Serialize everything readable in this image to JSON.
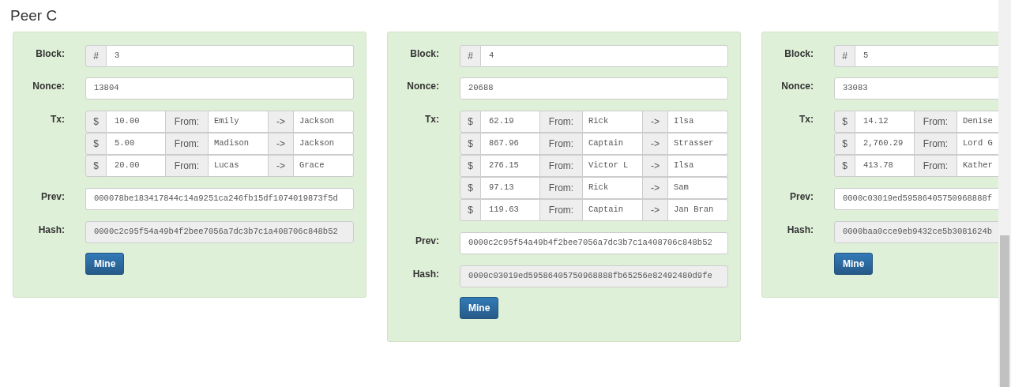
{
  "title": "Peer C",
  "blocks": [
    {
      "block_label": "Block:",
      "hash_symbol": "#",
      "block": "3",
      "nonce_label": "Nonce:",
      "nonce": "13804",
      "tx_label": "Tx:",
      "txs": [
        {
          "currency": "$",
          "amount": "10.00",
          "from_label": "From:",
          "from": "Emily",
          "arrow": "->",
          "to": "Jackson"
        },
        {
          "currency": "$",
          "amount": "5.00",
          "from_label": "From:",
          "from": "Madison",
          "arrow": "->",
          "to": "Jackson"
        },
        {
          "currency": "$",
          "amount": "20.00",
          "from_label": "From:",
          "from": "Lucas",
          "arrow": "->",
          "to": "Grace"
        }
      ],
      "prev_label": "Prev:",
      "prev": "000078be183417844c14a9251ca246fb15df1074019873f5d",
      "hash_label": "Hash:",
      "hash": "0000c2c95f54a49b4f2bee7056a7dc3b7c1a408706c848b52",
      "mine_button": "Mine"
    },
    {
      "block_label": "Block:",
      "hash_symbol": "#",
      "block": "4",
      "nonce_label": "Nonce:",
      "nonce": "20688",
      "tx_label": "Tx:",
      "txs": [
        {
          "currency": "$",
          "amount": "62.19",
          "from_label": "From:",
          "from": "Rick",
          "arrow": "->",
          "to": "Ilsa"
        },
        {
          "currency": "$",
          "amount": "867.96",
          "from_label": "From:",
          "from": "Captain",
          "arrow": "->",
          "to": "Strasser"
        },
        {
          "currency": "$",
          "amount": "276.15",
          "from_label": "From:",
          "from": "Victor L",
          "arrow": "->",
          "to": "Ilsa"
        },
        {
          "currency": "$",
          "amount": "97.13",
          "from_label": "From:",
          "from": "Rick",
          "arrow": "->",
          "to": "Sam"
        },
        {
          "currency": "$",
          "amount": "119.63",
          "from_label": "From:",
          "from": "Captain",
          "arrow": "->",
          "to": "Jan Bran"
        }
      ],
      "prev_label": "Prev:",
      "prev": "0000c2c95f54a49b4f2bee7056a7dc3b7c1a408706c848b52",
      "hash_label": "Hash:",
      "hash": "0000c03019ed59586405750968888fb65256e82492480d9fe",
      "mine_button": "Mine"
    },
    {
      "block_label": "Block:",
      "hash_symbol": "#",
      "block": "5",
      "nonce_label": "Nonce:",
      "nonce": "33083",
      "tx_label": "Tx:",
      "txs": [
        {
          "currency": "$",
          "amount": "14.12",
          "from_label": "From:",
          "from": "Denise"
        },
        {
          "currency": "$",
          "amount": "2,760.29",
          "from_label": "From:",
          "from": "Lord G"
        },
        {
          "currency": "$",
          "amount": "413.78",
          "from_label": "From:",
          "from": "Kather"
        }
      ],
      "prev_label": "Prev:",
      "prev": "0000c03019ed59586405750968888f",
      "hash_label": "Hash:",
      "hash": "0000baa0cce9eb9432ce5b3081624b",
      "mine_button": "Mine"
    }
  ]
}
